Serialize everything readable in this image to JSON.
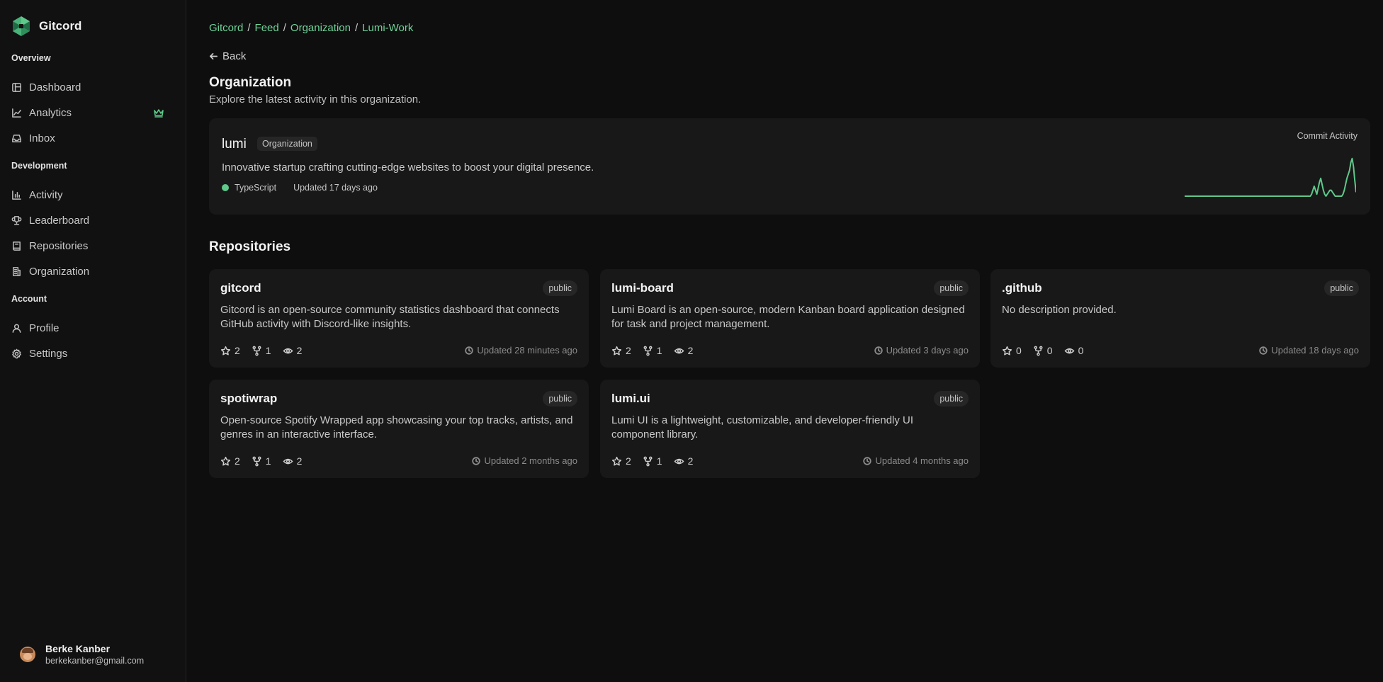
{
  "brand": {
    "name": "Gitcord"
  },
  "sidebar": {
    "sections": [
      {
        "title": "Overview"
      },
      {
        "title": "Development"
      },
      {
        "title": "Account"
      }
    ],
    "items": [
      {
        "label": "Dashboard",
        "icon": "dashboard-icon"
      },
      {
        "label": "Analytics",
        "icon": "chart-line-icon",
        "badge_icon": "crown-icon"
      },
      {
        "label": "Inbox",
        "icon": "inbox-icon"
      },
      {
        "label": "Activity",
        "icon": "bar-chart-icon"
      },
      {
        "label": "Leaderboard",
        "icon": "trophy-icon"
      },
      {
        "label": "Repositories",
        "icon": "book-icon"
      },
      {
        "label": "Organization",
        "icon": "building-icon"
      },
      {
        "label": "Profile",
        "icon": "user-icon"
      },
      {
        "label": "Settings",
        "icon": "gear-icon"
      }
    ],
    "user": {
      "name": "Berke Kanber",
      "email": "berkekanber@gmail.com"
    }
  },
  "breadcrumb": [
    "Gitcord",
    "Feed",
    "Organization",
    "Lumi-Work"
  ],
  "back_label": "Back",
  "page": {
    "title": "Organization",
    "subtitle": "Explore the latest activity in this organization."
  },
  "org": {
    "name": "lumi",
    "badge": "Organization",
    "description": "Innovative startup crafting cutting-edge websites to boost your digital presence.",
    "language": "TypeScript",
    "updated": "Updated 17 days ago",
    "activity_label": "Commit Activity",
    "activity_color": "#5fc88a",
    "activity_values": [
      0,
      0,
      0,
      0,
      0,
      0,
      0,
      0,
      0,
      0,
      0,
      0,
      0,
      0,
      0,
      0,
      0,
      0,
      0,
      0,
      0,
      0,
      0,
      0,
      0,
      0,
      0,
      0,
      0,
      0,
      0,
      0,
      0,
      0,
      0,
      0,
      0,
      0,
      0,
      0,
      0,
      0,
      0,
      0,
      0,
      0,
      0,
      0,
      0,
      0,
      0,
      0,
      0,
      0,
      0,
      0,
      0,
      0,
      0,
      0,
      0,
      0,
      0,
      0,
      0,
      0,
      0,
      0,
      0,
      0,
      0,
      0,
      0,
      0,
      0,
      0,
      0,
      0,
      0,
      0,
      0,
      0,
      0,
      0,
      0,
      0,
      0,
      0,
      0,
      0,
      0,
      0,
      0,
      0,
      0,
      0,
      0,
      1,
      3,
      5,
      3,
      1,
      4,
      7,
      9,
      6,
      3,
      1,
      0,
      1,
      2,
      3,
      3,
      2,
      1,
      0,
      0,
      0,
      0,
      0,
      0,
      1,
      3,
      6,
      9,
      11,
      13,
      17,
      19,
      15,
      8,
      2
    ],
    "activity_max": 20
  },
  "repositories_title": "Repositories",
  "repositories": [
    {
      "name": "gitcord",
      "visibility": "public",
      "description": "Gitcord is an open-source community statistics dashboard that connects GitHub activity with Discord-like insights.",
      "stars": "2",
      "forks": "1",
      "watchers": "2",
      "updated": "Updated 28 minutes ago"
    },
    {
      "name": "lumi-board",
      "visibility": "public",
      "description": "Lumi Board is an open-source, modern Kanban board application designed for task and project management.",
      "stars": "2",
      "forks": "1",
      "watchers": "2",
      "updated": "Updated 3 days ago"
    },
    {
      "name": ".github",
      "visibility": "public",
      "description": "No description provided.",
      "stars": "0",
      "forks": "0",
      "watchers": "0",
      "updated": "Updated 18 days ago"
    },
    {
      "name": "spotiwrap",
      "visibility": "public",
      "description": "Open-source Spotify Wrapped app showcasing your top tracks, artists, and genres in an interactive interface.",
      "stars": "2",
      "forks": "1",
      "watchers": "2",
      "updated": "Updated 2 months ago"
    },
    {
      "name": "lumi.ui",
      "visibility": "public",
      "description": "Lumi UI is a lightweight, customizable, and developer-friendly UI component library.",
      "stars": "2",
      "forks": "1",
      "watchers": "2",
      "updated": "Updated 4 months ago"
    }
  ]
}
